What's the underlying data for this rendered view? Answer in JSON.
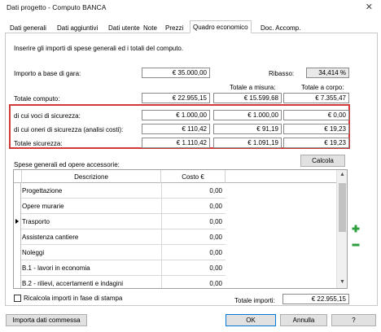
{
  "window": {
    "title": "Dati progetto - Computo BANCA",
    "close": "✕"
  },
  "tabs": [
    {
      "label": "Dati generali"
    },
    {
      "label": "Dati aggiuntivi"
    },
    {
      "label": "Dati utente"
    },
    {
      "label": "Note"
    },
    {
      "label": "Prezzi"
    },
    {
      "label": "Quadro economico",
      "active": true
    },
    {
      "label": "Doc. Accomp."
    }
  ],
  "intro": "Inserire gli importi di spese generali ed i totali del computo.",
  "importo": {
    "label": "Importo a base di gara:",
    "value": "€ 35.000,00"
  },
  "ribasso": {
    "label": "Ribasso:",
    "value": "34,414 %"
  },
  "totals_headers": {
    "misura": "Totale a misura:",
    "corpo": "Totale a corpo:"
  },
  "totale_computo": {
    "label": "Totale computo:",
    "value": "€ 22.955,15",
    "misura": "€ 15.599,68",
    "corpo": "€ 7.355,47"
  },
  "sicurezza": {
    "voci": {
      "label": "di cui voci di sicurezza:",
      "v1": "€ 1.000,00",
      "v2": "€ 1.000,00",
      "v3": "€ 0,00"
    },
    "oneri": {
      "label": "di cui oneri di sicurezza (analisi costi):",
      "v1": "€ 110,42",
      "v2": "€ 91,19",
      "v3": "€ 19,23"
    },
    "totale": {
      "label": "Totale sicurezza:",
      "v1": "€ 1.110,42",
      "v2": "€ 1.091,19",
      "v3": "€ 19,23"
    }
  },
  "spese": {
    "label": "Spese generali ed opere accessorie:",
    "calcola": "Calcola",
    "columns": [
      "Descrizione",
      "Costo €"
    ],
    "rows": [
      {
        "desc": "Progettazione",
        "cost": "0,00"
      },
      {
        "desc": "Opere murarie",
        "cost": "0,00"
      },
      {
        "desc": "Trasporto",
        "cost": "0,00",
        "current": true
      },
      {
        "desc": "Assistenza cantiere",
        "cost": "0,00"
      },
      {
        "desc": "Noleggi",
        "cost": "0,00"
      },
      {
        "desc": "B.1 - lavori in economia",
        "cost": "0,00"
      },
      {
        "desc": "B.2 - rilievi, accertamenti e indagini",
        "cost": "0,00"
      }
    ]
  },
  "ricalcola": {
    "label": "Ricalcola importi in fase di stampa",
    "checked": false
  },
  "totale_importi": {
    "label": "Totale importi:",
    "value": "€ 22.955,15"
  },
  "buttons": {
    "importa": "Importa dati commessa",
    "ok": "OK",
    "annulla": "Annulla",
    "help": "?"
  },
  "colors": {
    "highlight_border": "#d23a3a",
    "plus": "#2e9e3e",
    "minus": "#2e9e3e"
  }
}
